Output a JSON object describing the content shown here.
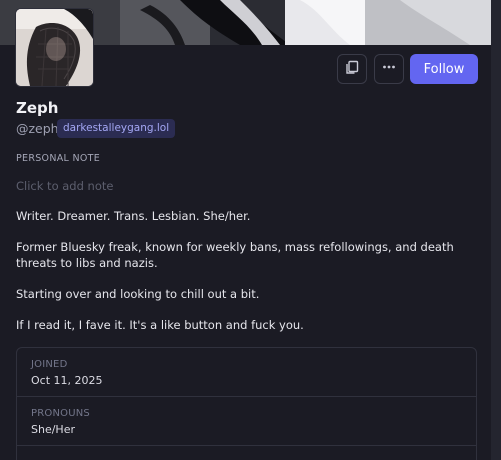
{
  "profile": {
    "display_name": "Zeph",
    "handle": "@zeph",
    "domain": "darkestalleygang.lol"
  },
  "actions": {
    "copy_icon": "copy-icon",
    "more_icon": "more-horizontal-icon",
    "follow_label": "Follow"
  },
  "personal_note": {
    "heading": "PERSONAL NOTE",
    "placeholder": "Click to add note"
  },
  "bio": [
    "Writer. Dreamer. Trans. Lesbian. She/her.",
    "Former Bluesky freak, known for weekly bans, mass refollowings, and death threats to libs and nazis.",
    "Starting over and looking to chill out a bit.",
    "If I read it, I fave it. It's a like button and fuck you."
  ],
  "info": {
    "joined_label": "JOINED",
    "joined_value": "Oct 11, 2025",
    "pronouns_label": "PRONOUNS",
    "pronouns_value": "She/Her"
  },
  "colors": {
    "background": "#1b1b24",
    "accent": "#6366f1",
    "badge_bg": "#2b2c52",
    "badge_text": "#a4a7f4"
  }
}
